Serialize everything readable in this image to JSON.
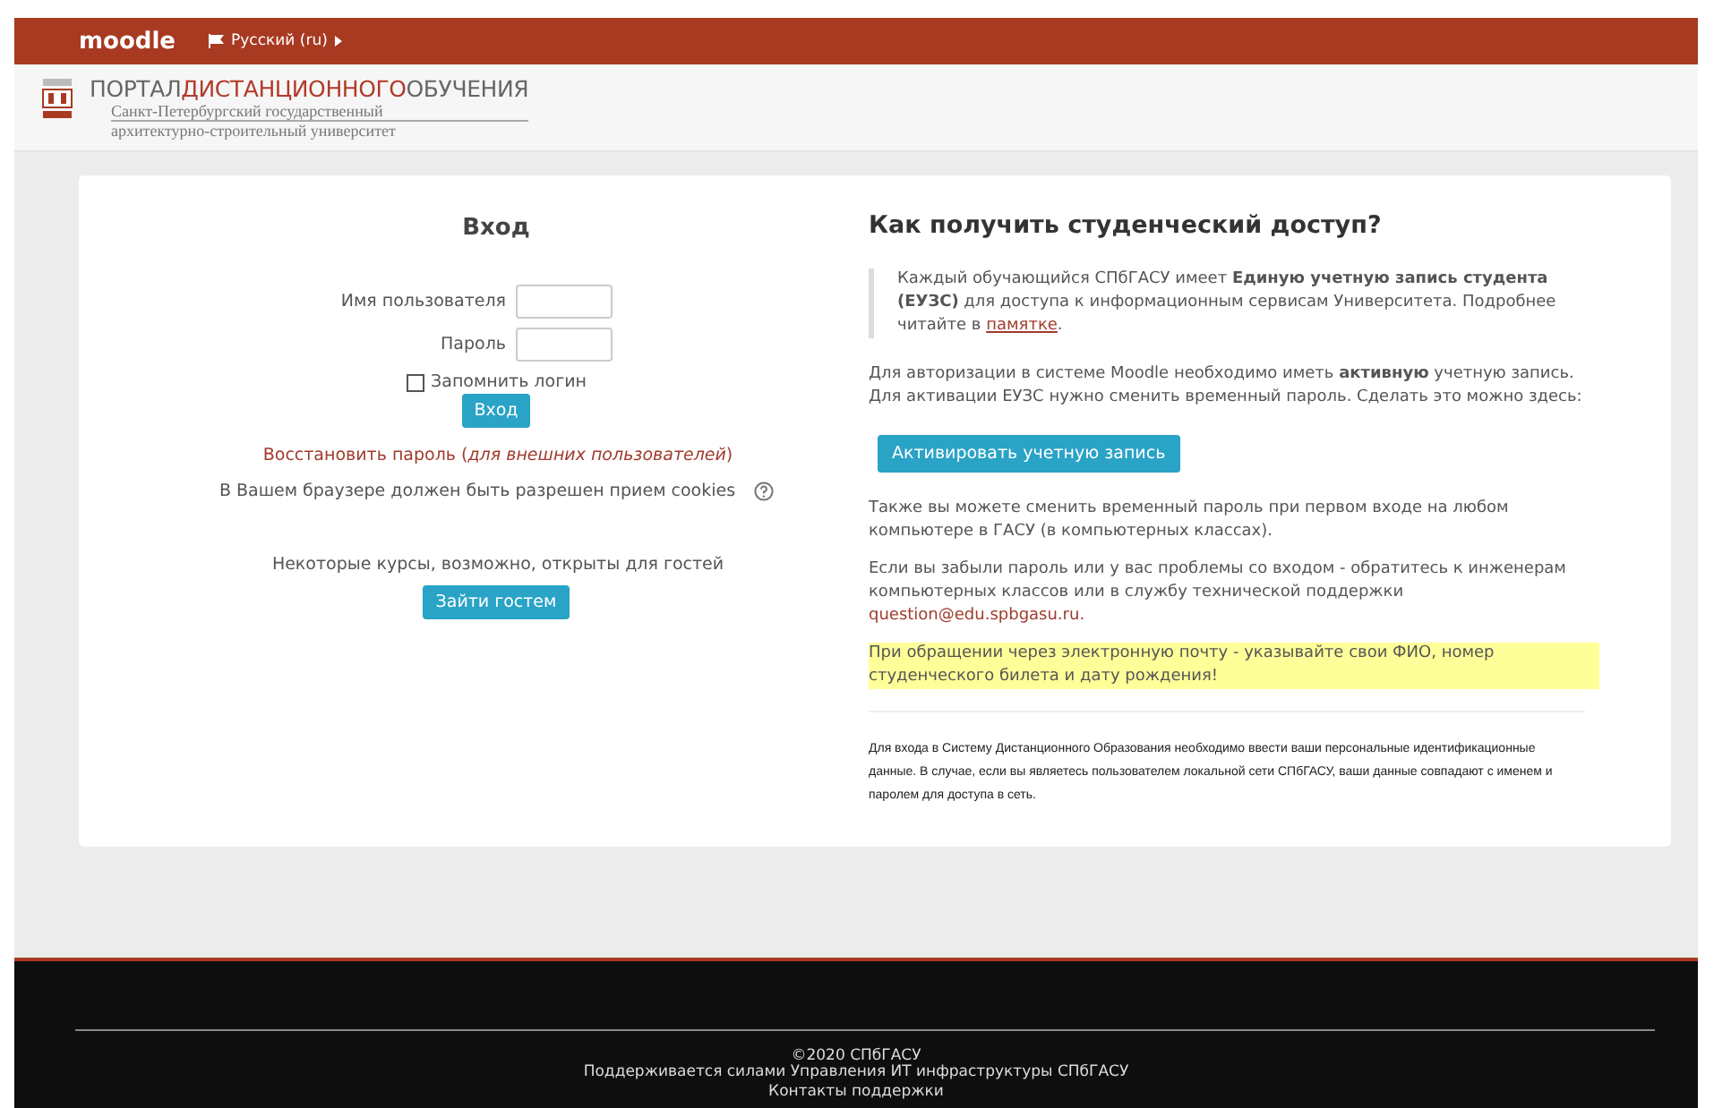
{
  "navbar": {
    "brand": "moodle",
    "language": "Русский (ru)"
  },
  "header": {
    "title_parts": [
      {
        "text": "ПОРТАЛ",
        "kind": "plain"
      },
      {
        "text": "ДИСТАНЦИОННОГО",
        "kind": "accent"
      },
      {
        "text": "ОБУЧЕНИЯ",
        "kind": "plain"
      }
    ],
    "subtitle_lines": [
      "Санкт-Петербургский государственный",
      "архитектурно-строительный университет"
    ]
  },
  "login": {
    "heading": "Вход",
    "fields": [
      {
        "label": "Имя пользователя"
      },
      {
        "label": "Пароль"
      }
    ],
    "remember": {
      "label": "Запомнить логин",
      "checked": false
    },
    "submit": "Вход",
    "recover": "Восстановить пароль (*для внешних пользователей*)",
    "cookies_note": "В Вашем браузере должен быть разрешен прием cookies",
    "guest_note": "Некоторые курсы, возможно, открыты для гостей",
    "guest_button": "Зайти гостем"
  },
  "info": {
    "heading": "Как получить студенческий доступ?",
    "quote": {
      "text": "Каждый обучающийся СПбГАСУ имеет **Единую учетную запись студента (ЕУЗС)** для доступа к информационным сервисам Университета. Подробнее читайте в ",
      "link": "памятке",
      "after": "."
    },
    "blocks": [
      {
        "kind": "text",
        "text": "Для авторизации в системе Moodle необходимо иметь **активную** учетную запись. Для активации ЕУЗС нужно сменить временный пароль. Сделать это можно здесь:"
      },
      {
        "kind": "button",
        "text": "Активировать учетную запись"
      },
      {
        "kind": "text",
        "text": "Также вы можете сменить временный пароль при первом входе на любом компьютере в ГАСУ (в компьютерных классах)."
      },
      {
        "kind": "email",
        "text": "Если вы забыли пароль или у вас проблемы со входом - обратитесь к инженерам компьютерных классов или в службу технической поддержки ",
        "link": "question@edu.spbgasu.ru."
      },
      {
        "kind": "highlight",
        "text": "При обращении через электронную почту - указывайте свои ФИО, номер студенческого билета и дату рождения!"
      },
      {
        "kind": "small",
        "text": "Для входа в Систему Дистанционного Образования необходимо ввести ваши персональные идентификационные данные. В случае, если вы являетесь пользователем локальной сети СПбГАСУ, ваши данные совпадают с именем и паролем для доступа в сеть."
      }
    ]
  },
  "footer": {
    "copyright": "©2020 СПбГАСУ",
    "support": "Поддерживается силами Управления ИТ инфраструктуры СПбГАСУ",
    "contacts": "Контакты поддержки"
  }
}
